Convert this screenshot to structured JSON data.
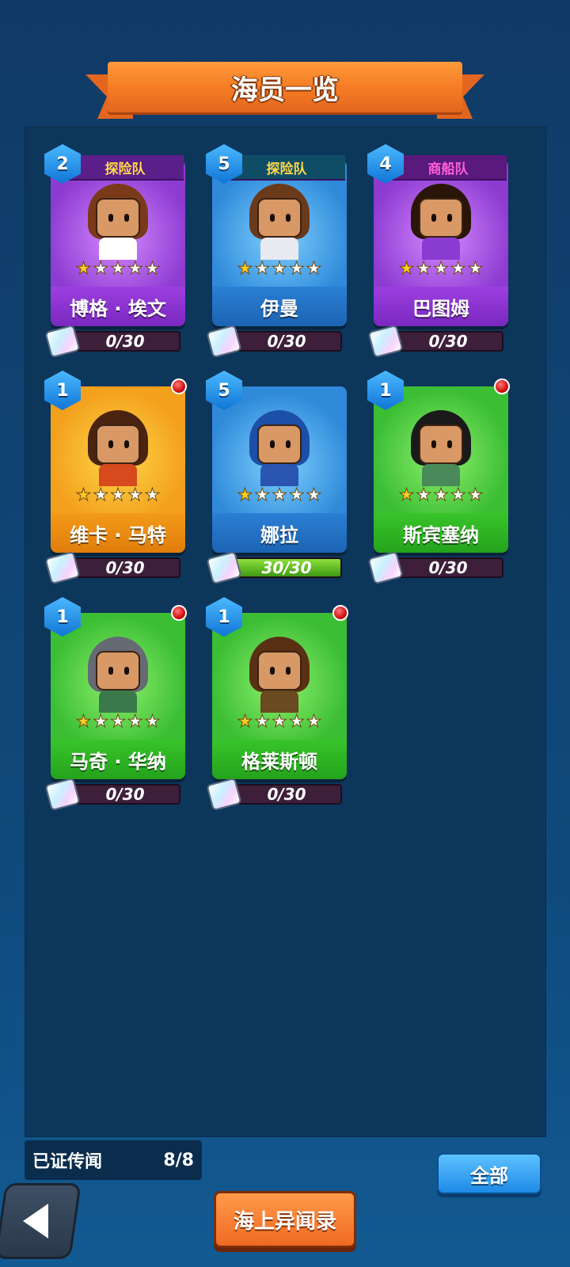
{
  "title": "海员一览",
  "crew": [
    {
      "name": "博格 · 埃文",
      "level": "2",
      "team": "探险队",
      "team_style": "purple",
      "theme": "purple",
      "stars": 1,
      "shards": "0/30",
      "shards_full": false,
      "alert": false,
      "hair": "#7a3a1a",
      "body": "#ffffff"
    },
    {
      "name": "伊曼",
      "level": "5",
      "team": "探险队",
      "team_style": "teal",
      "theme": "blue",
      "stars": 1,
      "shards": "0/30",
      "shards_full": false,
      "alert": false,
      "hair": "#6b3a1a",
      "body": "#e8eaf0"
    },
    {
      "name": "巴图姆",
      "level": "4",
      "team": "商船队",
      "team_style": "pink",
      "theme": "purple",
      "stars": 1,
      "shards": "0/30",
      "shards_full": false,
      "alert": false,
      "hair": "#2a1608",
      "body": "#8a3bd1"
    },
    {
      "name": "维卡 · 马特",
      "level": "1",
      "team": "",
      "team_style": "",
      "theme": "orange",
      "stars": 1,
      "shards": "0/30",
      "shards_full": false,
      "alert": true,
      "hair": "#4a2410",
      "body": "#d64a1e"
    },
    {
      "name": "娜拉",
      "level": "5",
      "team": "",
      "team_style": "",
      "theme": "blue",
      "stars": 1,
      "shards": "30/30",
      "shards_full": true,
      "alert": false,
      "hair": "#1c4fa8",
      "body": "#2a55b0"
    },
    {
      "name": "斯宾塞纳",
      "level": "1",
      "team": "",
      "team_style": "",
      "theme": "green",
      "stars": 1,
      "shards": "0/30",
      "shards_full": false,
      "alert": true,
      "hair": "#1a1a1a",
      "body": "#4a8a5a"
    },
    {
      "name": "马奇 · 华纳",
      "level": "1",
      "team": "",
      "team_style": "",
      "theme": "green",
      "stars": 1,
      "shards": "0/30",
      "shards_full": false,
      "alert": true,
      "hair": "#666a74",
      "body": "#3a7a4a"
    },
    {
      "name": "格莱斯顿",
      "level": "1",
      "team": "",
      "team_style": "",
      "theme": "green",
      "stars": 1,
      "shards": "0/30",
      "shards_full": false,
      "alert": true,
      "hair": "#5a3014",
      "body": "#6a4a20"
    }
  ],
  "rumor": {
    "label": "已证传闻",
    "count": "8/8"
  },
  "buttons": {
    "all": "全部",
    "log": "海上异闻录"
  },
  "icons": {
    "back": "back-arrow-icon",
    "shard": "puzzle-piece-icon",
    "alert": "red-dot-icon",
    "level": "hexagon-badge-icon"
  }
}
